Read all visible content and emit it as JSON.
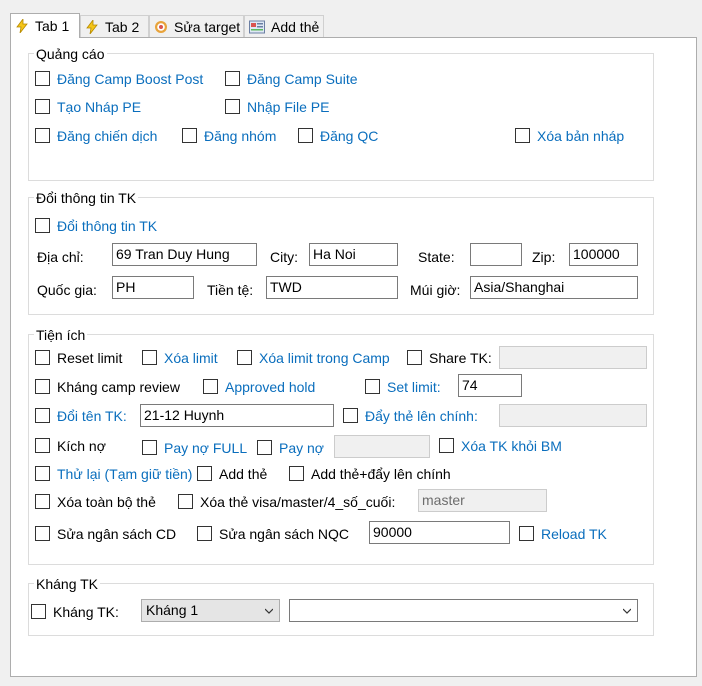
{
  "tabs": [
    {
      "label": "Tab 1",
      "icon": "lightning-icon"
    },
    {
      "label": "Tab 2",
      "icon": "lightning-icon"
    },
    {
      "label": "Sửa target",
      "icon": "target-icon"
    },
    {
      "label": "Add thẻ",
      "icon": "card-icon"
    }
  ],
  "quangcao": {
    "title": "Quảng cáo",
    "items": [
      "Đăng Camp Boost Post",
      "Đăng Camp Suite",
      "Tạo Nháp PE",
      "Nhập File PE",
      "Đăng chiến dịch",
      "Đăng nhóm",
      "Đăng QC",
      "Xóa bản nháp"
    ]
  },
  "doithongtin": {
    "title": "Đổi thông tin TK",
    "checkbox": "Đổi thông tin TK",
    "diachi_label": "Địa chỉ:",
    "diachi_value": "69 Tran Duy Hung",
    "city_label": "City:",
    "city_value": "Ha Noi",
    "state_label": "State:",
    "state_value": "",
    "zip_label": "Zip:",
    "zip_value": "100000",
    "quocgia_label": "Quốc gia:",
    "quocgia_value": "PH",
    "tiente_label": "Tiền tệ:",
    "tiente_value": "TWD",
    "muigio_label": "Múi giờ:",
    "muigio_value": "Asia/Shanghai"
  },
  "tienich": {
    "title": "Tiện ích",
    "reset_limit": "Reset limit",
    "xoa_limit": "Xóa limit",
    "xoa_limit_camp": "Xóa limit trong Camp",
    "share_tk": "Share TK:",
    "share_value": "",
    "khang_camp": "Kháng camp review",
    "approved_hold": "Approved hold",
    "set_limit": "Set limit:",
    "set_limit_value": "74",
    "doi_ten": "Đổi tên TK:",
    "doi_ten_value": "21-12 Huynh",
    "day_the": "Đẩy thẻ lên chính:",
    "day_the_value": "",
    "kich_no": "Kích nợ",
    "pay_full": "Pay nợ FULL",
    "pay_no": "Pay nợ",
    "pay_no_value": "",
    "xoa_bm": "Xóa TK khỏi BM",
    "thu_lai": "Thử lại (Tạm giữ tiền)",
    "add_the": "Add thẻ",
    "add_the_day": "Add thẻ+đẩy lên chính",
    "xoa_toan_bo": "Xóa toàn bộ thẻ",
    "xoa_the_visa": "Xóa thẻ visa/master/4_số_cuối:",
    "xoa_the_value": "master",
    "sua_cd": "Sửa ngân sách CD",
    "sua_nqc": "Sửa ngân sách NQC",
    "sua_value": "90000",
    "reload": "Reload TK"
  },
  "khangtk": {
    "title": "Kháng TK",
    "label": "Kháng TK:",
    "select1": "Kháng 1",
    "select2": ""
  }
}
